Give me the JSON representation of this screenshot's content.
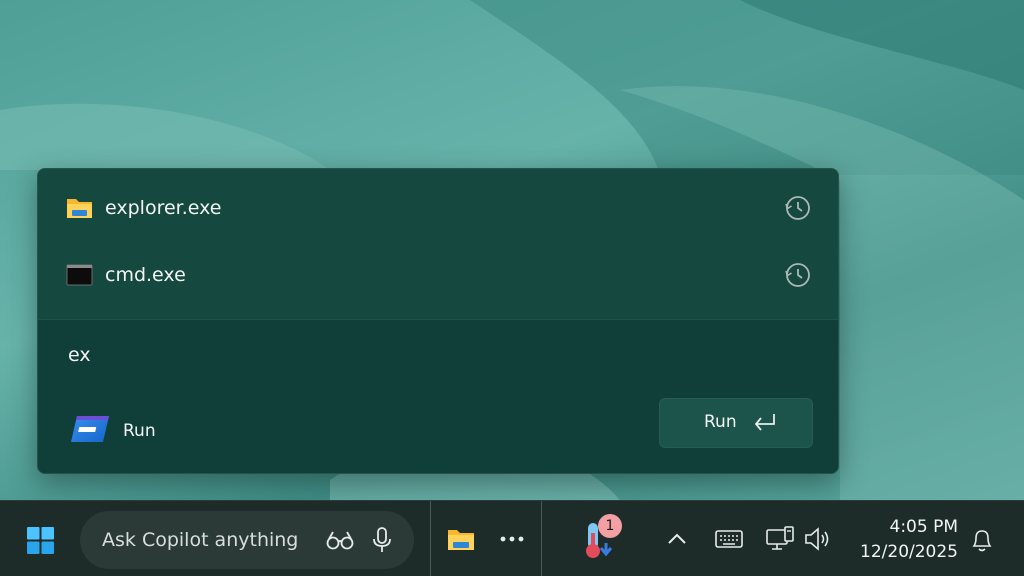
{
  "run_dialog": {
    "history": [
      {
        "name": "explorer.exe",
        "icon": "file-explorer-icon"
      },
      {
        "name": "cmd.exe",
        "icon": "command-prompt-icon"
      }
    ],
    "query": "ex",
    "app_label": "Run",
    "run_button_label": "Run"
  },
  "taskbar": {
    "search_placeholder": "Ask Copilot anything",
    "weather_badge": "1",
    "time": "4:05 PM",
    "date": "12/20/2025"
  },
  "colors": {
    "popup_bg": "#12463f",
    "taskbar_bg": "#1d2b29",
    "badge": "#f3a0a4"
  }
}
